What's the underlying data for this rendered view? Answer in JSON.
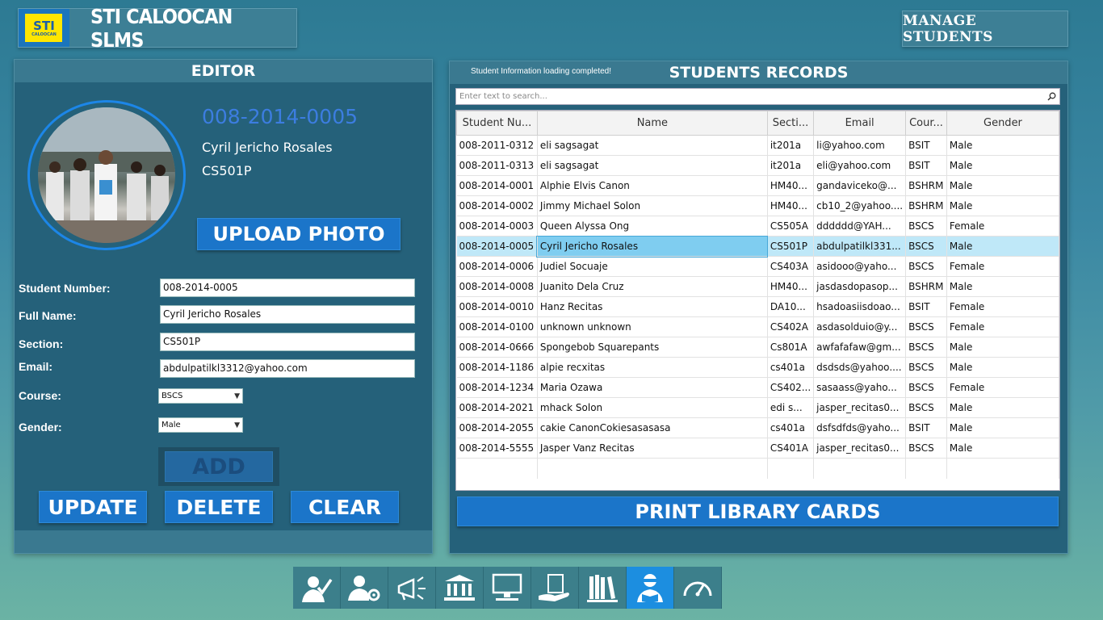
{
  "app": {
    "title": "STI CALOOCAN SLMS",
    "logo_text": "STI",
    "logo_sub": "CALOOCAN",
    "manage_label": "MANAGE STUDENTS"
  },
  "editor": {
    "header": "EDITOR",
    "display_number": "008-2014-0005",
    "display_name": "Cyril Jericho Rosales",
    "display_section": "CS501P",
    "upload_label": "UPLOAD PHOTO",
    "labels": {
      "student_number": "Student Number:",
      "full_name": "Full Name:",
      "section": "Section:",
      "email": "Email:",
      "course": "Course:",
      "gender": "Gender:"
    },
    "values": {
      "student_number": "008-2014-0005",
      "full_name": "Cyril Jericho Rosales",
      "section": "CS501P",
      "email": "abdulpatilkl3312@yahoo.com",
      "course": "BSCS",
      "gender": "Male"
    },
    "buttons": {
      "add": "ADD",
      "update": "UPDATE",
      "delete": "DELETE",
      "clear": "CLEAR"
    }
  },
  "records": {
    "header": "STUDENTS RECORDS",
    "status": "Student Information loading completed!",
    "search_placeholder": "Enter text to search...",
    "columns": [
      "Student Nu...",
      "Name",
      "Secti...",
      "Email",
      "Cour...",
      "Gender"
    ],
    "rows": [
      [
        "008-2011-0312",
        "eli sagsagat",
        "it201a",
        "li@yahoo.com",
        "BSIT",
        "Male"
      ],
      [
        "008-2011-0313",
        "eli sagsagat",
        "it201a",
        "eli@yahoo.com",
        "BSIT",
        "Male"
      ],
      [
        "008-2014-0001",
        "Alphie Elvis Canon",
        "HM40...",
        "gandaviceko@...",
        "BSHRM",
        "Male"
      ],
      [
        "008-2014-0002",
        "Jimmy Michael Solon",
        "HM40...",
        "cb10_2@yahoo....",
        "BSHRM",
        "Male"
      ],
      [
        "008-2014-0003",
        "Queen Alyssa Ong",
        "CS505A",
        "dddddd@YAH...",
        "BSCS",
        "Female"
      ],
      [
        "008-2014-0005",
        "Cyril Jericho Rosales",
        "CS501P",
        "abdulpatilkl331...",
        "BSCS",
        "Male"
      ],
      [
        "008-2014-0006",
        "Judiel Socuaje",
        "CS403A",
        "asidooo@yaho...",
        "BSCS",
        "Female"
      ],
      [
        "008-2014-0008",
        "Juanito Dela Cruz",
        "HM40...",
        "jasdasdopasop...",
        "BSHRM",
        "Male"
      ],
      [
        "008-2014-0010",
        "Hanz Recitas",
        "DA10...",
        "hsadoasiisdoao...",
        "BSIT",
        "Female"
      ],
      [
        "008-2014-0100",
        "unknown unknown",
        "CS402A",
        "asdasolduio@y...",
        "BSCS",
        "Female"
      ],
      [
        "008-2014-0666",
        "Spongebob Squarepants",
        "Cs801A",
        "awfafafaw@gm...",
        "BSCS",
        "Male"
      ],
      [
        "008-2014-1186",
        "alpie recxitas",
        "cs401a",
        "dsdsds@yahoo....",
        "BSCS",
        "Male"
      ],
      [
        "008-2014-1234",
        "Maria Ozawa",
        "CS402...",
        "sasaass@yaho...",
        "BSCS",
        "Female"
      ],
      [
        "008-2014-2021",
        "mhack Solon",
        "edi s...",
        "jasper_recitas0...",
        "BSCS",
        "Male"
      ],
      [
        "008-2014-2055",
        "cakie CanonCokiesasasasa",
        "cs401a",
        "dsfsdfds@yaho...",
        "BSIT",
        "Male"
      ],
      [
        "008-2014-5555",
        "Jasper Vanz Recitas",
        "CS401A",
        "jasper_recitas0...",
        "BSCS",
        "Male"
      ]
    ],
    "selected_index": 5,
    "print_label": "PRINT LIBRARY CARDS"
  },
  "toolbar": {
    "items": [
      {
        "icon": "user-check-icon"
      },
      {
        "icon": "user-settings-icon"
      },
      {
        "icon": "megaphone-icon"
      },
      {
        "icon": "library-building-icon"
      },
      {
        "icon": "computer-icon"
      },
      {
        "icon": "book-in-hand-icon"
      },
      {
        "icon": "bookshelf-icon"
      },
      {
        "icon": "student-reading-icon",
        "active": true
      },
      {
        "icon": "speedometer-icon"
      }
    ]
  },
  "colors": {
    "accent_blue": "#1b75c9",
    "highlight_number": "#3c7de0",
    "selected_row": "#bfe8f8",
    "active_tool": "#1c8ee0"
  }
}
